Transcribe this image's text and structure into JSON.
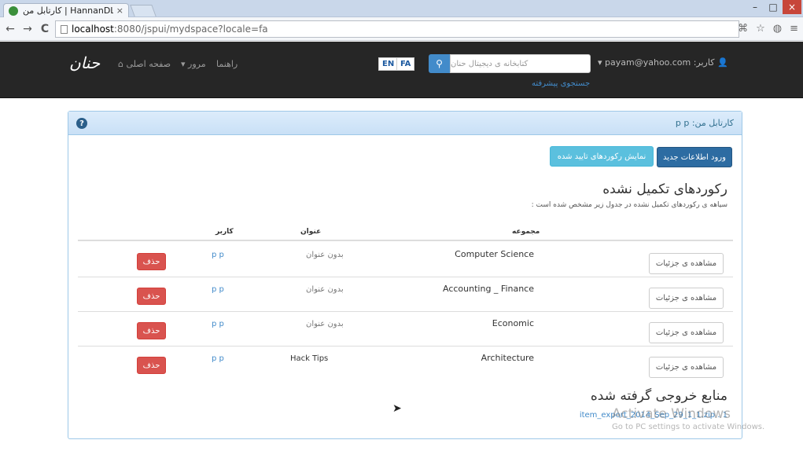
{
  "browser": {
    "tab_title": "کارتابل من | HannanDL",
    "tab_close": "×",
    "url_host": "localhost",
    "url_rest": ":8080/jspui/mydspace?locale=fa",
    "win_min": "–",
    "win_max": "□",
    "win_close": "×",
    "back": "←",
    "forward": "→",
    "reload": "C"
  },
  "navbar": {
    "logo": "حنان",
    "home": "صفحه اصلی",
    "browse": "مرور",
    "help": "راهنما",
    "lang_en": "EN",
    "lang_fa": "FA",
    "search_placeholder": "کتابخانه ی دیجیتال حنان",
    "advanced_search": "جستجوی پیشرفته",
    "user": "کاربر: payam@yahoo.com"
  },
  "panel": {
    "title": "کارتابل من: p p",
    "new_submission": "ورود اطلاعات جدید",
    "show_approved": "نمایش رکوردهای تایید شده",
    "unfinished_title": "رکوردهای تکمیل نشده",
    "unfinished_sub": "سیاهه ی رکوردهای تکمیل نشده در جدول زیر مشخص شده است :",
    "columns": {
      "collection": "مجموعه",
      "title": "عنوان",
      "user": "کاربر"
    },
    "rows": [
      {
        "collection": "Computer Science",
        "title": "بدون عنوان",
        "user": "p p",
        "view": "مشاهده ی جزئیات",
        "delete": "حذف"
      },
      {
        "collection": "Accounting _ Finance",
        "title": "بدون عنوان",
        "user": "p p",
        "view": "مشاهده ی جزئیات",
        "delete": "حذف"
      },
      {
        "collection": "Economic",
        "title": "بدون عنوان",
        "user": "p p",
        "view": "مشاهده ی جزئیات",
        "delete": "حذف"
      },
      {
        "collection": "Architecture",
        "title": "Hack Tips",
        "user": "p p",
        "view": "مشاهده ی جزئیات",
        "delete": "حذف"
      }
    ],
    "exports_title": "منابع خروجی گرفته شده",
    "export_link": "item_export_2014_Sep_29_1_1.zip . 1"
  },
  "watermark": {
    "line1": "Activate Windows",
    "line2": "Go to PC settings to activate Windows."
  },
  "colors": {
    "navbar": "#262626",
    "primary": "#2d6ca2",
    "danger": "#d9534f",
    "info": "#5bc0de"
  }
}
